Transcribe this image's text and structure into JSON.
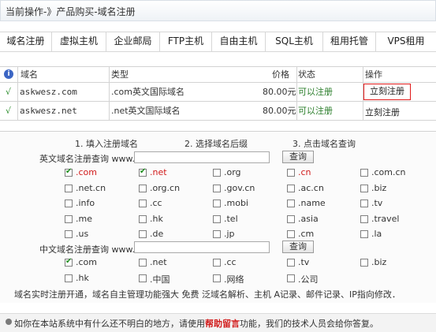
{
  "breadcrumb": "当前操作-》产品购买-域名注册",
  "tabs": [
    "域名注册",
    "虚拟主机",
    "企业邮局",
    "FTP主机",
    "自由主机",
    "SQL主机",
    "租用托管",
    "VPS租用"
  ],
  "results": {
    "headers": {
      "domain": "域名",
      "type": "类型",
      "price": "价格",
      "status": "状态",
      "action": "操作"
    },
    "info_icon": "i",
    "rows": [
      {
        "mark": "√",
        "domain": "askwesz.com",
        "type": ".com英文国际域名",
        "price": "80.00元",
        "status": "可以注册",
        "action": "立刻注册"
      },
      {
        "mark": "√",
        "domain": "askwesz.net",
        "type": ".net英文国际域名",
        "price": "80.00元",
        "status": "可以注册",
        "action": "立刻注册"
      }
    ]
  },
  "steps": [
    "1.  填入注册域名",
    "2.  选择域名后缀",
    "3.  点击域名查询"
  ],
  "english": {
    "label": "英文域名注册查询 www.",
    "input_value": "",
    "button": "查询",
    "tlds": [
      {
        "name": ".com",
        "checked": true,
        "red": true
      },
      {
        "name": ".net",
        "checked": true,
        "red": true
      },
      {
        "name": ".org",
        "checked": false,
        "red": false
      },
      {
        "name": ".cn",
        "checked": false,
        "red": true
      },
      {
        "name": ".com.cn",
        "checked": false,
        "red": false
      },
      {
        "name": ".net.cn",
        "checked": false,
        "red": false
      },
      {
        "name": ".org.cn",
        "checked": false,
        "red": false
      },
      {
        "name": ".gov.cn",
        "checked": false,
        "red": false
      },
      {
        "name": ".ac.cn",
        "checked": false,
        "red": false
      },
      {
        "name": ".biz",
        "checked": false,
        "red": false
      },
      {
        "name": ".info",
        "checked": false,
        "red": false
      },
      {
        "name": ".cc",
        "checked": false,
        "red": false
      },
      {
        "name": ".mobi",
        "checked": false,
        "red": false
      },
      {
        "name": ".name",
        "checked": false,
        "red": false
      },
      {
        "name": ".tv",
        "checked": false,
        "red": false
      },
      {
        "name": ".me",
        "checked": false,
        "red": false
      },
      {
        "name": ".hk",
        "checked": false,
        "red": false
      },
      {
        "name": ".tel",
        "checked": false,
        "red": false
      },
      {
        "name": ".asia",
        "checked": false,
        "red": false
      },
      {
        "name": ".travel",
        "checked": false,
        "red": false
      },
      {
        "name": ".us",
        "checked": false,
        "red": false
      },
      {
        "name": ".de",
        "checked": false,
        "red": false
      },
      {
        "name": ".jp",
        "checked": false,
        "red": false
      },
      {
        "name": ".cm",
        "checked": false,
        "red": false
      },
      {
        "name": ".la",
        "checked": false,
        "red": false
      }
    ]
  },
  "chinese": {
    "label": "中文域名注册查询 www.",
    "input_value": "",
    "button": "查询",
    "tlds": [
      {
        "name": ".com",
        "checked": true,
        "red": false
      },
      {
        "name": ".net",
        "checked": false,
        "red": false
      },
      {
        "name": ".cc",
        "checked": false,
        "red": false
      },
      {
        "name": ".tv",
        "checked": false,
        "red": false
      },
      {
        "name": ".biz",
        "checked": false,
        "red": false
      },
      {
        "name": ".hk",
        "checked": false,
        "red": false
      },
      {
        "name": ".中国",
        "checked": false,
        "red": false
      },
      {
        "name": ".网络",
        "checked": false,
        "red": false
      },
      {
        "name": ".公司",
        "checked": false,
        "red": false
      }
    ]
  },
  "promo": "域名实时注册开通，域名自主管理功能强大 免费 泛域名解析、主机 A记录、邮件记录、IP指向修改．",
  "footer": {
    "before": "如你在本站系统中有什么还不明白的地方，请使用",
    "link": "帮助留言",
    "after": "功能，我们的技术人员会给你答复。"
  },
  "colors": {
    "accent_red": "#d11a1a",
    "ok_green": "#2a7d2a",
    "border": "#d3d3d3"
  }
}
